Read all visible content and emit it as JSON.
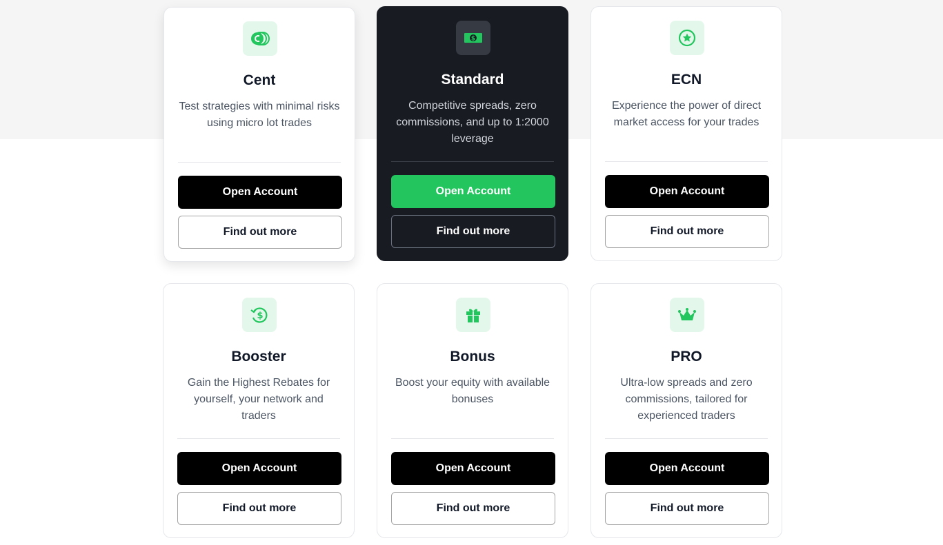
{
  "colors": {
    "accent_green": "#22c55e",
    "dark_card": "#181b22",
    "icon_bg": "#e3f8ea"
  },
  "cards": [
    {
      "icon": "coins-icon",
      "title": "Cent",
      "description": "Test strategies with minimal risks using micro lot trades",
      "open_label": "Open Account",
      "more_label": "Find out more"
    },
    {
      "icon": "banknote-icon",
      "title": "Standard",
      "description": "Competitive spreads, zero commissions, and up to 1:2000 leverage",
      "open_label": "Open Account",
      "more_label": "Find out more"
    },
    {
      "icon": "star-badge-icon",
      "title": "ECN",
      "description": "Experience the power of direct market access for your trades",
      "open_label": "Open Account",
      "more_label": "Find out more"
    },
    {
      "icon": "rebate-dollar-icon",
      "title": "Booster",
      "description": "Gain the Highest Rebates for yourself, your network and traders",
      "open_label": "Open Account",
      "more_label": "Find out more"
    },
    {
      "icon": "gift-icon",
      "title": "Bonus",
      "description": "Boost your equity with available bonuses",
      "open_label": "Open Account",
      "more_label": "Find out more"
    },
    {
      "icon": "crown-icon",
      "title": "PRO",
      "description": "Ultra-low spreads and zero commissions, tailored for experienced traders",
      "open_label": "Open Account",
      "more_label": "Find out more"
    }
  ]
}
